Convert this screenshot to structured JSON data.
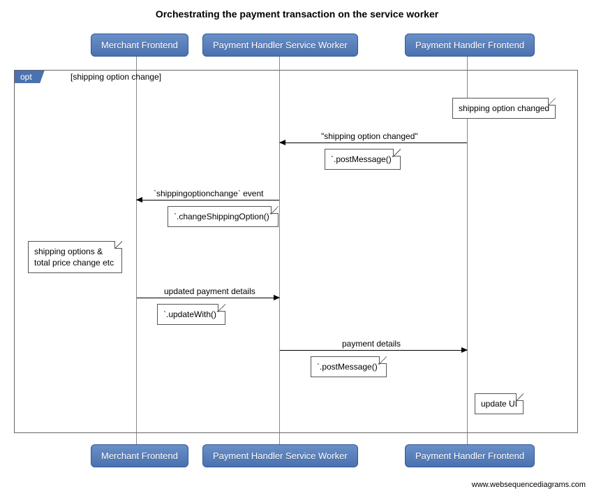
{
  "title": "Orchestrating the payment transaction on the service worker",
  "participants": {
    "p1": "Merchant Frontend",
    "p2": "Payment Handler Service Worker",
    "p3": "Payment Handler Frontend"
  },
  "opt": {
    "label": "opt",
    "guard": "[shipping option change]"
  },
  "messages": {
    "m1_label": "\"shipping option changed\"",
    "m1_note": "`.postMessage()`",
    "m2_label": "`shippingoptionchange` event",
    "m2_note": "`.changeShippingOption()`",
    "m3_label": "updated payment details",
    "m3_note": "`.updateWith()`",
    "m4_label": "payment details",
    "m4_note": "`.postMessage()`"
  },
  "notes": {
    "n1": "shipping option changed",
    "n2": "shipping options & total price change etc",
    "n3": "update UI"
  },
  "attribution": "www.websequencediagrams.com",
  "chart_data": {
    "type": "table",
    "diagram_kind": "sequence",
    "title": "Orchestrating the payment transaction on the service worker",
    "participants": [
      "Merchant Frontend",
      "Payment Handler Service Worker",
      "Payment Handler Frontend"
    ],
    "fragment": {
      "type": "opt",
      "guard": "shipping option change"
    },
    "steps": [
      {
        "type": "note",
        "over": "Payment Handler Frontend",
        "text": "shipping option changed"
      },
      {
        "type": "message",
        "from": "Payment Handler Frontend",
        "to": "Payment Handler Service Worker",
        "label": "\"shipping option changed\"",
        "call": ".postMessage()"
      },
      {
        "type": "message",
        "from": "Payment Handler Service Worker",
        "to": "Merchant Frontend",
        "label": "`shippingoptionchange` event",
        "call": ".changeShippingOption()"
      },
      {
        "type": "note",
        "over": "Merchant Frontend",
        "text": "shipping options & total price change etc"
      },
      {
        "type": "message",
        "from": "Merchant Frontend",
        "to": "Payment Handler Service Worker",
        "label": "updated payment details",
        "call": ".updateWith()"
      },
      {
        "type": "message",
        "from": "Payment Handler Service Worker",
        "to": "Payment Handler Frontend",
        "label": "payment details",
        "call": ".postMessage()"
      },
      {
        "type": "note",
        "over": "Payment Handler Frontend",
        "text": "update UI"
      }
    ]
  }
}
